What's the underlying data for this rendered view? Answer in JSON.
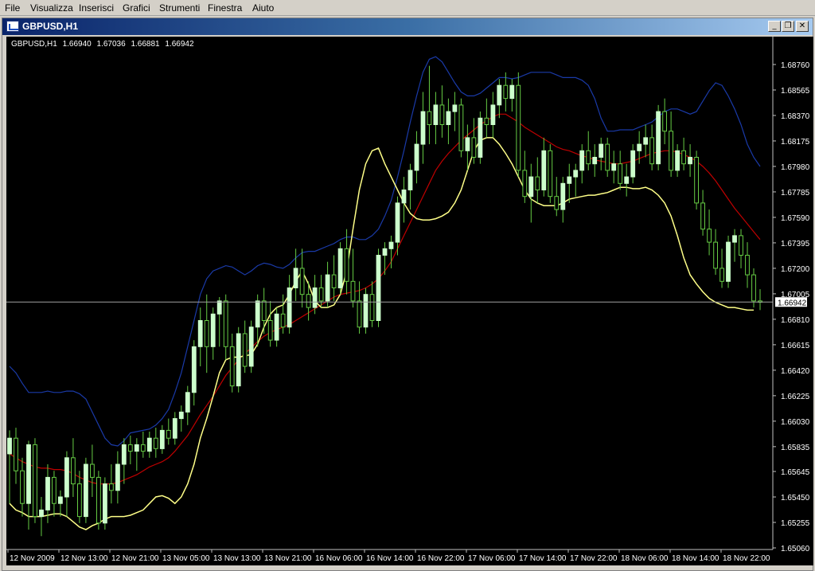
{
  "menu": {
    "items": [
      "File",
      "Visualizza",
      "Inserisci",
      "Grafici",
      "Strumenti",
      "Finestra",
      "Aiuto"
    ]
  },
  "window": {
    "title": "GBPUSD,H1",
    "buttons": [
      "minimize-icon",
      "restore-icon",
      "close-icon"
    ]
  },
  "chart_info": {
    "symbol": "GBPUSD,H1",
    "open": "1.66940",
    "high": "1.67036",
    "low": "1.66881",
    "close": "1.66942"
  },
  "chart_data": {
    "type": "candlestick",
    "symbol": "GBPUSD",
    "timeframe": "H1",
    "price_ticks": [
      "1.68760",
      "1.68565",
      "1.68370",
      "1.68175",
      "1.67980",
      "1.67785",
      "1.67590",
      "1.67395",
      "1.67200",
      "1.67005",
      "1.66810",
      "1.66615",
      "1.66420",
      "1.66225",
      "1.66030",
      "1.65835",
      "1.65645",
      "1.65450",
      "1.65255",
      "1.65060"
    ],
    "time_ticks": [
      "12 Nov 2009",
      "12 Nov 13:00",
      "12 Nov 21:00",
      "13 Nov 05:00",
      "13 Nov 13:00",
      "13 Nov 21:00",
      "16 Nov 06:00",
      "16 Nov 14:00",
      "16 Nov 22:00",
      "17 Nov 06:00",
      "17 Nov 14:00",
      "17 Nov 22:00",
      "18 Nov 06:00",
      "18 Nov 14:00",
      "18 Nov 22:00"
    ],
    "current_price": "1.66942",
    "colors": {
      "background": "#000000",
      "bull_candle": "#ccffcc",
      "bear_candle": "#000000",
      "wick": "#66cc44",
      "upper_band": "#1a3aa8",
      "middle_band": "#c00000",
      "lower_band": "#ffff88",
      "price_line": "#a0a0a0",
      "axis_text": "#ffffff"
    },
    "candles": [
      {
        "o": 1.6578,
        "h": 1.6596,
        "l": 1.654,
        "c": 1.659
      },
      {
        "o": 1.659,
        "h": 1.6598,
        "l": 1.6555,
        "c": 1.6565
      },
      {
        "o": 1.6565,
        "h": 1.6575,
        "l": 1.653,
        "c": 1.654
      },
      {
        "o": 1.654,
        "h": 1.6588,
        "l": 1.652,
        "c": 1.6585
      },
      {
        "o": 1.6585,
        "h": 1.659,
        "l": 1.6525,
        "c": 1.653
      },
      {
        "o": 1.653,
        "h": 1.6545,
        "l": 1.6515,
        "c": 1.6535
      },
      {
        "o": 1.6535,
        "h": 1.657,
        "l": 1.6525,
        "c": 1.656
      },
      {
        "o": 1.656,
        "h": 1.6565,
        "l": 1.653,
        "c": 1.654
      },
      {
        "o": 1.654,
        "h": 1.655,
        "l": 1.653,
        "c": 1.6545
      },
      {
        "o": 1.6545,
        "h": 1.658,
        "l": 1.653,
        "c": 1.6575
      },
      {
        "o": 1.6575,
        "h": 1.659,
        "l": 1.6545,
        "c": 1.6555
      },
      {
        "o": 1.6555,
        "h": 1.6565,
        "l": 1.6525,
        "c": 1.653
      },
      {
        "o": 1.653,
        "h": 1.6575,
        "l": 1.6525,
        "c": 1.657
      },
      {
        "o": 1.657,
        "h": 1.6585,
        "l": 1.6545,
        "c": 1.656
      },
      {
        "o": 1.656,
        "h": 1.6565,
        "l": 1.652,
        "c": 1.6525
      },
      {
        "o": 1.6525,
        "h": 1.656,
        "l": 1.652,
        "c": 1.6555
      },
      {
        "o": 1.6555,
        "h": 1.657,
        "l": 1.654,
        "c": 1.655
      },
      {
        "o": 1.655,
        "h": 1.658,
        "l": 1.654,
        "c": 1.657
      },
      {
        "o": 1.657,
        "h": 1.659,
        "l": 1.6555,
        "c": 1.6585
      },
      {
        "o": 1.6585,
        "h": 1.6592,
        "l": 1.657,
        "c": 1.658
      },
      {
        "o": 1.658,
        "h": 1.659,
        "l": 1.6565,
        "c": 1.6585
      },
      {
        "o": 1.6585,
        "h": 1.6595,
        "l": 1.6575,
        "c": 1.658
      },
      {
        "o": 1.658,
        "h": 1.6595,
        "l": 1.6575,
        "c": 1.659
      },
      {
        "o": 1.659,
        "h": 1.6598,
        "l": 1.6575,
        "c": 1.6582
      },
      {
        "o": 1.6582,
        "h": 1.66,
        "l": 1.6578,
        "c": 1.6596
      },
      {
        "o": 1.6596,
        "h": 1.6605,
        "l": 1.6585,
        "c": 1.659
      },
      {
        "o": 1.659,
        "h": 1.661,
        "l": 1.6585,
        "c": 1.6605
      },
      {
        "o": 1.6605,
        "h": 1.6615,
        "l": 1.6595,
        "c": 1.661
      },
      {
        "o": 1.661,
        "h": 1.663,
        "l": 1.66,
        "c": 1.6625
      },
      {
        "o": 1.6625,
        "h": 1.6665,
        "l": 1.6615,
        "c": 1.666
      },
      {
        "o": 1.666,
        "h": 1.669,
        "l": 1.6645,
        "c": 1.668
      },
      {
        "o": 1.668,
        "h": 1.67,
        "l": 1.664,
        "c": 1.666
      },
      {
        "o": 1.666,
        "h": 1.669,
        "l": 1.665,
        "c": 1.6685
      },
      {
        "o": 1.6685,
        "h": 1.6698,
        "l": 1.666,
        "c": 1.6695
      },
      {
        "o": 1.6695,
        "h": 1.67,
        "l": 1.665,
        "c": 1.666
      },
      {
        "o": 1.666,
        "h": 1.667,
        "l": 1.6625,
        "c": 1.663
      },
      {
        "o": 1.663,
        "h": 1.6675,
        "l": 1.6625,
        "c": 1.667
      },
      {
        "o": 1.667,
        "h": 1.668,
        "l": 1.664,
        "c": 1.6645
      },
      {
        "o": 1.6645,
        "h": 1.668,
        "l": 1.664,
        "c": 1.6675
      },
      {
        "o": 1.6675,
        "h": 1.67,
        "l": 1.666,
        "c": 1.6695
      },
      {
        "o": 1.6695,
        "h": 1.6705,
        "l": 1.667,
        "c": 1.668
      },
      {
        "o": 1.668,
        "h": 1.6695,
        "l": 1.666,
        "c": 1.6665
      },
      {
        "o": 1.6665,
        "h": 1.669,
        "l": 1.666,
        "c": 1.6685
      },
      {
        "o": 1.6685,
        "h": 1.67,
        "l": 1.667,
        "c": 1.6675
      },
      {
        "o": 1.6675,
        "h": 1.6715,
        "l": 1.667,
        "c": 1.6705
      },
      {
        "o": 1.6705,
        "h": 1.6735,
        "l": 1.6695,
        "c": 1.672
      },
      {
        "o": 1.672,
        "h": 1.6735,
        "l": 1.669,
        "c": 1.67
      },
      {
        "o": 1.67,
        "h": 1.671,
        "l": 1.668,
        "c": 1.669
      },
      {
        "o": 1.669,
        "h": 1.6715,
        "l": 1.6685,
        "c": 1.6705
      },
      {
        "o": 1.6705,
        "h": 1.6715,
        "l": 1.669,
        "c": 1.6695
      },
      {
        "o": 1.6695,
        "h": 1.6725,
        "l": 1.669,
        "c": 1.6715
      },
      {
        "o": 1.6715,
        "h": 1.673,
        "l": 1.6695,
        "c": 1.6705
      },
      {
        "o": 1.6705,
        "h": 1.674,
        "l": 1.67,
        "c": 1.6735
      },
      {
        "o": 1.6735,
        "h": 1.675,
        "l": 1.67,
        "c": 1.671
      },
      {
        "o": 1.671,
        "h": 1.6735,
        "l": 1.669,
        "c": 1.6695
      },
      {
        "o": 1.6695,
        "h": 1.671,
        "l": 1.667,
        "c": 1.6675
      },
      {
        "o": 1.6675,
        "h": 1.6705,
        "l": 1.667,
        "c": 1.67
      },
      {
        "o": 1.67,
        "h": 1.671,
        "l": 1.6675,
        "c": 1.668
      },
      {
        "o": 1.668,
        "h": 1.6735,
        "l": 1.6675,
        "c": 1.673
      },
      {
        "o": 1.673,
        "h": 1.674,
        "l": 1.6715,
        "c": 1.6735
      },
      {
        "o": 1.6735,
        "h": 1.6745,
        "l": 1.672,
        "c": 1.674
      },
      {
        "o": 1.674,
        "h": 1.6775,
        "l": 1.673,
        "c": 1.677
      },
      {
        "o": 1.677,
        "h": 1.679,
        "l": 1.6755,
        "c": 1.678
      },
      {
        "o": 1.678,
        "h": 1.68,
        "l": 1.6765,
        "c": 1.6795
      },
      {
        "o": 1.6795,
        "h": 1.6825,
        "l": 1.6785,
        "c": 1.6815
      },
      {
        "o": 1.6815,
        "h": 1.6855,
        "l": 1.68,
        "c": 1.684
      },
      {
        "o": 1.684,
        "h": 1.6875,
        "l": 1.6815,
        "c": 1.683
      },
      {
        "o": 1.683,
        "h": 1.6855,
        "l": 1.6815,
        "c": 1.6845
      },
      {
        "o": 1.6845,
        "h": 1.686,
        "l": 1.682,
        "c": 1.683
      },
      {
        "o": 1.683,
        "h": 1.685,
        "l": 1.6815,
        "c": 1.684
      },
      {
        "o": 1.684,
        "h": 1.6855,
        "l": 1.6825,
        "c": 1.6845
      },
      {
        "o": 1.6845,
        "h": 1.685,
        "l": 1.6805,
        "c": 1.681
      },
      {
        "o": 1.681,
        "h": 1.683,
        "l": 1.6795,
        "c": 1.682
      },
      {
        "o": 1.682,
        "h": 1.6835,
        "l": 1.68,
        "c": 1.6805
      },
      {
        "o": 1.6805,
        "h": 1.684,
        "l": 1.68,
        "c": 1.6835
      },
      {
        "o": 1.6835,
        "h": 1.685,
        "l": 1.682,
        "c": 1.683
      },
      {
        "o": 1.683,
        "h": 1.6855,
        "l": 1.682,
        "c": 1.6845
      },
      {
        "o": 1.6845,
        "h": 1.6865,
        "l": 1.6835,
        "c": 1.686
      },
      {
        "o": 1.686,
        "h": 1.687,
        "l": 1.684,
        "c": 1.685
      },
      {
        "o": 1.685,
        "h": 1.6865,
        "l": 1.684,
        "c": 1.686
      },
      {
        "o": 1.686,
        "h": 1.687,
        "l": 1.679,
        "c": 1.6795
      },
      {
        "o": 1.6795,
        "h": 1.681,
        "l": 1.677,
        "c": 1.6775
      },
      {
        "o": 1.6775,
        "h": 1.68,
        "l": 1.6755,
        "c": 1.679
      },
      {
        "o": 1.679,
        "h": 1.6805,
        "l": 1.677,
        "c": 1.678
      },
      {
        "o": 1.678,
        "h": 1.682,
        "l": 1.6775,
        "c": 1.681
      },
      {
        "o": 1.681,
        "h": 1.6815,
        "l": 1.677,
        "c": 1.6775
      },
      {
        "o": 1.6775,
        "h": 1.679,
        "l": 1.676,
        "c": 1.6765
      },
      {
        "o": 1.6765,
        "h": 1.679,
        "l": 1.6755,
        "c": 1.6785
      },
      {
        "o": 1.6785,
        "h": 1.68,
        "l": 1.677,
        "c": 1.679
      },
      {
        "o": 1.679,
        "h": 1.68,
        "l": 1.6775,
        "c": 1.6795
      },
      {
        "o": 1.6795,
        "h": 1.6815,
        "l": 1.6785,
        "c": 1.681
      },
      {
        "o": 1.681,
        "h": 1.6825,
        "l": 1.6795,
        "c": 1.68
      },
      {
        "o": 1.68,
        "h": 1.6815,
        "l": 1.679,
        "c": 1.6805
      },
      {
        "o": 1.6805,
        "h": 1.682,
        "l": 1.6795,
        "c": 1.6815
      },
      {
        "o": 1.6815,
        "h": 1.682,
        "l": 1.679,
        "c": 1.6795
      },
      {
        "o": 1.6795,
        "h": 1.681,
        "l": 1.6785,
        "c": 1.68
      },
      {
        "o": 1.68,
        "h": 1.681,
        "l": 1.678,
        "c": 1.6785
      },
      {
        "o": 1.6785,
        "h": 1.68,
        "l": 1.6775,
        "c": 1.679
      },
      {
        "o": 1.679,
        "h": 1.6815,
        "l": 1.6785,
        "c": 1.681
      },
      {
        "o": 1.681,
        "h": 1.6825,
        "l": 1.68,
        "c": 1.6815
      },
      {
        "o": 1.6815,
        "h": 1.683,
        "l": 1.6805,
        "c": 1.682
      },
      {
        "o": 1.682,
        "h": 1.683,
        "l": 1.6795,
        "c": 1.68
      },
      {
        "o": 1.68,
        "h": 1.6845,
        "l": 1.6795,
        "c": 1.684
      },
      {
        "o": 1.684,
        "h": 1.685,
        "l": 1.6815,
        "c": 1.6825
      },
      {
        "o": 1.6825,
        "h": 1.684,
        "l": 1.679,
        "c": 1.6795
      },
      {
        "o": 1.6795,
        "h": 1.6815,
        "l": 1.679,
        "c": 1.681
      },
      {
        "o": 1.681,
        "h": 1.682,
        "l": 1.6795,
        "c": 1.68
      },
      {
        "o": 1.68,
        "h": 1.6815,
        "l": 1.679,
        "c": 1.6805
      },
      {
        "o": 1.6805,
        "h": 1.681,
        "l": 1.6765,
        "c": 1.677
      },
      {
        "o": 1.677,
        "h": 1.678,
        "l": 1.6745,
        "c": 1.675
      },
      {
        "o": 1.675,
        "h": 1.6765,
        "l": 1.673,
        "c": 1.674
      },
      {
        "o": 1.674,
        "h": 1.675,
        "l": 1.6715,
        "c": 1.672
      },
      {
        "o": 1.672,
        "h": 1.6735,
        "l": 1.6705,
        "c": 1.671
      },
      {
        "o": 1.671,
        "h": 1.6745,
        "l": 1.6705,
        "c": 1.674
      },
      {
        "o": 1.674,
        "h": 1.675,
        "l": 1.6725,
        "c": 1.6745
      },
      {
        "o": 1.6745,
        "h": 1.675,
        "l": 1.672,
        "c": 1.673
      },
      {
        "o": 1.673,
        "h": 1.674,
        "l": 1.6705,
        "c": 1.6715
      },
      {
        "o": 1.6715,
        "h": 1.672,
        "l": 1.669,
        "c": 1.6695
      },
      {
        "o": 1.6695,
        "h": 1.6704,
        "l": 1.6688,
        "c": 1.6694
      }
    ],
    "upper_band": [
      1.6645,
      1.664,
      1.6632,
      1.6625,
      1.6625,
      1.6625,
      1.6626,
      1.6625,
      1.6625,
      1.6626,
      1.6626,
      1.6624,
      1.662,
      1.661,
      1.66,
      1.659,
      1.6585,
      1.6584,
      1.6588,
      1.6594,
      1.6595,
      1.6596,
      1.6597,
      1.66,
      1.6605,
      1.6612,
      1.6625,
      1.664,
      1.666,
      1.668,
      1.67,
      1.6712,
      1.6718,
      1.672,
      1.6722,
      1.6721,
      1.6718,
      1.6715,
      1.6718,
      1.6722,
      1.6724,
      1.6723,
      1.6721,
      1.672,
      1.6723,
      1.6728,
      1.6732,
      1.6733,
      1.6733,
      1.6735,
      1.6737,
      1.6739,
      1.6742,
      1.6744,
      1.6744,
      1.6742,
      1.6742,
      1.6745,
      1.675,
      1.676,
      1.6772,
      1.679,
      1.681,
      1.6832,
      1.6852,
      1.687,
      1.688,
      1.6882,
      1.6878,
      1.687,
      1.6862,
      1.6855,
      1.6852,
      1.6852,
      1.6854,
      1.6858,
      1.6862,
      1.6866,
      1.6866,
      1.6865,
      1.6866,
      1.6868,
      1.687,
      1.687,
      1.687,
      1.687,
      1.6868,
      1.6866,
      1.6866,
      1.6866,
      1.6864,
      1.686,
      1.685,
      1.6835,
      1.6825,
      1.6825,
      1.6826,
      1.6826,
      1.6826,
      1.6828,
      1.683,
      1.6832,
      1.6836,
      1.684,
      1.6842,
      1.6842,
      1.684,
      1.6838,
      1.684,
      1.6848,
      1.6856,
      1.6862,
      1.686,
      1.6852,
      1.6842,
      1.683,
      1.6815,
      1.6805,
      1.6798
    ],
    "middle_band": [
      1.6578,
      1.6575,
      1.6572,
      1.657,
      1.6568,
      1.6567,
      1.6567,
      1.6566,
      1.6566,
      1.6565,
      1.6563,
      1.656,
      1.6558,
      1.6556,
      1.6555,
      1.6555,
      1.6555,
      1.6556,
      1.6558,
      1.656,
      1.6562,
      1.6565,
      1.6568,
      1.657,
      1.6572,
      1.6575,
      1.658,
      1.6586,
      1.6592,
      1.66,
      1.6608,
      1.6615,
      1.6622,
      1.663,
      1.6638,
      1.6644,
      1.665,
      1.6655,
      1.6659,
      1.6664,
      1.6668,
      1.6671,
      1.6673,
      1.6675,
      1.6677,
      1.668,
      1.6683,
      1.6686,
      1.6689,
      1.6692,
      1.6695,
      1.6698,
      1.67,
      1.6701,
      1.6702,
      1.6703,
      1.6705,
      1.6708,
      1.6712,
      1.6718,
      1.6725,
      1.6735,
      1.6745,
      1.6755,
      1.6765,
      1.6775,
      1.6785,
      1.6795,
      1.6802,
      1.6808,
      1.6813,
      1.6818,
      1.6822,
      1.6826,
      1.683,
      1.6833,
      1.6836,
      1.6838,
      1.6838,
      1.6835,
      1.6832,
      1.6828,
      1.6825,
      1.6822,
      1.6819,
      1.6816,
      1.6813,
      1.6811,
      1.681,
      1.6808,
      1.6806,
      1.6805,
      1.6803,
      1.6802,
      1.6801,
      1.68,
      1.68,
      1.6801,
      1.6802,
      1.6804,
      1.6806,
      1.6808,
      1.6809,
      1.681,
      1.681,
      1.6809,
      1.6807,
      1.6805,
      1.6802,
      1.6798,
      1.6793,
      1.6787,
      1.678,
      1.6773,
      1.6766,
      1.676,
      1.6754,
      1.6748,
      1.6742
    ],
    "lower_band": [
      1.654,
      1.6535,
      1.6533,
      1.653,
      1.653,
      1.653,
      1.6531,
      1.6532,
      1.6532,
      1.653,
      1.6526,
      1.6522,
      1.652,
      1.6523,
      1.6525,
      1.6528,
      1.653,
      1.653,
      1.653,
      1.6531,
      1.6533,
      1.6535,
      1.654,
      1.6545,
      1.6546,
      1.6544,
      1.654,
      1.6545,
      1.6555,
      1.657,
      1.659,
      1.6605,
      1.6622,
      1.664,
      1.665,
      1.6652,
      1.6652,
      1.6653,
      1.6654,
      1.6662,
      1.6675,
      1.6685,
      1.669,
      1.6692,
      1.67,
      1.671,
      1.6718,
      1.6708,
      1.6695,
      1.669,
      1.669,
      1.6692,
      1.67,
      1.6718,
      1.675,
      1.678,
      1.68,
      1.681,
      1.6812,
      1.68,
      1.679,
      1.678,
      1.677,
      1.6762,
      1.6758,
      1.6757,
      1.6757,
      1.6758,
      1.676,
      1.6763,
      1.677,
      1.678,
      1.6795,
      1.681,
      1.6818,
      1.682,
      1.682,
      1.6815,
      1.6808,
      1.68,
      1.679,
      1.678,
      1.6773,
      1.677,
      1.6768,
      1.6768,
      1.6768,
      1.677,
      1.6773,
      1.6774,
      1.6775,
      1.6776,
      1.6776,
      1.6777,
      1.6778,
      1.678,
      1.6782,
      1.6782,
      1.6781,
      1.6781,
      1.6782,
      1.678,
      1.6776,
      1.677,
      1.676,
      1.6745,
      1.6728,
      1.6715,
      1.6708,
      1.6702,
      1.6697,
      1.6694,
      1.6692,
      1.669,
      1.669,
      1.6689,
      1.6688,
      1.6688
    ]
  }
}
